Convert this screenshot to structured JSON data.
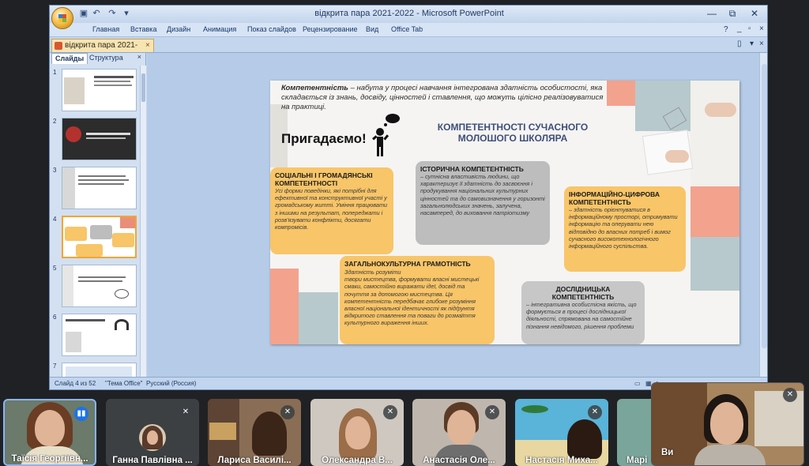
{
  "window": {
    "title": "відкрита пара 2021-2022 - Microsoft PowerPoint",
    "minimize": "—",
    "restore": "⧉",
    "close": "✕"
  },
  "menu": {
    "items": [
      "Главная",
      "Вставка",
      "Дизайн",
      "Анимация",
      "Показ слайдов",
      "Рецензирование",
      "Вид",
      "Office Tab"
    ]
  },
  "doc_tab": {
    "label": "відкрита пара 2021-2022",
    "close": "×"
  },
  "pane": {
    "tab_slides": "Слайды",
    "tab_outline": "Структура",
    "close": "×",
    "slide_numbers": [
      "1",
      "2",
      "3",
      "4",
      "5",
      "6",
      "7"
    ],
    "selected_index": 4
  },
  "status": {
    "slide": "Слайд 4 из 52",
    "theme": "\"Тема Office\"",
    "language": "Русский (Россия)"
  },
  "slide": {
    "definition_term": "Компетентність",
    "definition_rest": " – набута у процесі навчання інтегрована здатність особистості, яка складається із знань, досвіду, цінностей і ставлення, що можуть цілісно реалізовуватися на практиці.",
    "remember": "Пригадаємо!",
    "title": "КОМПЕТЕНТНОСТІ СУЧАСНОГО МОЛОШОГО ШКОЛЯРА",
    "cards": {
      "social_title": "СОЦІАЛЬНІ І ГРОМАДЯНСЬКІ КОМПЕТЕНТНОСТІ",
      "social_text": "Усі форми поведінки, які потрібні для ефективної та конструктивної участі у громадському житті. Уміння працювати з іншими на результат, попереджати і розв'язувати конфлікти, досягати компромісів.",
      "history_title": "ІСТОРИЧНА КОМПЕТЕНТНІСТЬ",
      "history_text": "– сутнісна властивість людини, що характеризує її здатність до засвоєння і продукування національних культурних цінностей та до самовизначення у горизонті загальнолюдських значень, залучена, насамперед, до виховання патріотизму",
      "info_title": "ІНФОРМАЦІЙНО-ЦИФРОВА КОМПЕТЕНТНІСТЬ",
      "info_text": "– здатність орієнтуватися в інформаційному просторі, отримувати інформацію та оперувати нею відповідно до власних потреб і вимог сучасного високотехнологічного інформаційного суспільства.",
      "general_title": "ЗАГАЛЬНОКУЛЬТУРНА ГРАМОТНІСТЬ",
      "general_text_inline": "Здатність розуміти",
      "general_text": "твори мистецтва, формувати власні мистецькі смаки, самостійно виражати ідеї, досвід та почуття за допомогою мистецтва. Ця компетентність передбачає глибоке розуміння власної національної ідентичності як підґрунтя відкритого ставлення та поваги до розмаїття культурного вираження інших.",
      "research_title": "ДОСЛІДНИЦЬКА КОМПЕТЕНТНІСТЬ",
      "research_text": "– інтегративна особистісна якість, що формується в процесі дослідницької діяльності, спрямована на самостійне пізнання невідомого, рішення проблеми"
    }
  },
  "participants": [
    {
      "name": "Таїсія Георгіївн...",
      "mic": "on"
    },
    {
      "name": "Ганна Павлівна ...",
      "mic": "off"
    },
    {
      "name": "Лариса Василі...",
      "mic": "off"
    },
    {
      "name": "Олександра В...",
      "mic": "off"
    },
    {
      "name": "Анастасія Оле...",
      "mic": "off"
    },
    {
      "name": "Настасія Миха...",
      "mic": "off"
    },
    {
      "name": "Марі",
      "mic": "off"
    },
    {
      "name": "Ви",
      "mic": "off"
    }
  ],
  "colors": {
    "card_yellow": "#f8c568",
    "card_gray": "#bdbdbd",
    "title_blue": "#3e4e7a",
    "active_speaker": "#8ab4f8"
  }
}
